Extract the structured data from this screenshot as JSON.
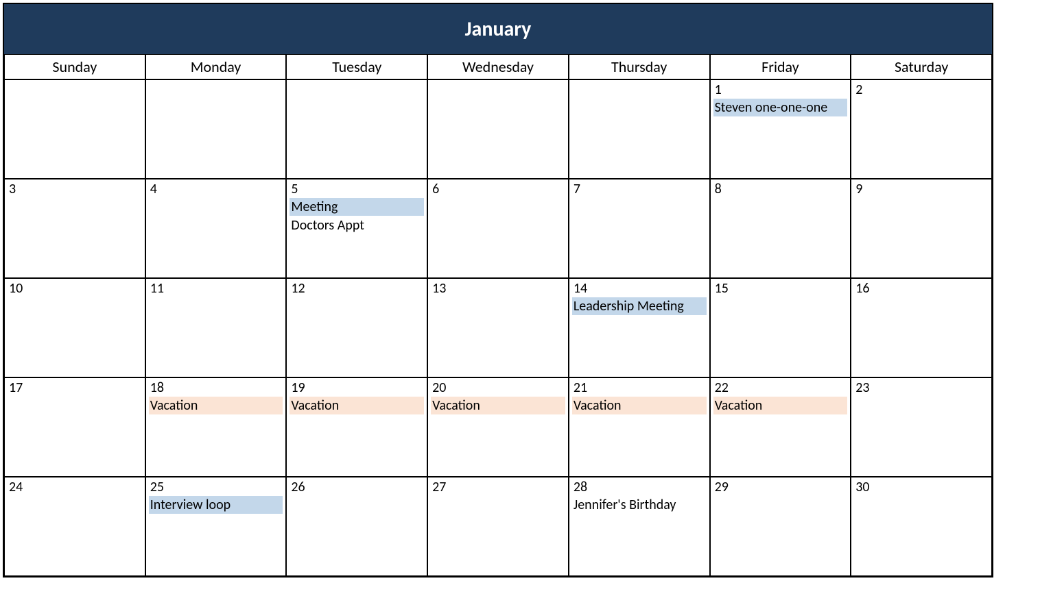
{
  "month_title": "January",
  "day_names": [
    "Sunday",
    "Monday",
    "Tuesday",
    "Wednesday",
    "Thursday",
    "Friday",
    "Saturday"
  ],
  "colors": {
    "header_bg": "#1f3b5c",
    "event_blue": "#c3d7ea",
    "event_peach": "#fbe4d5"
  },
  "weeks": [
    [
      {
        "day": "",
        "events": []
      },
      {
        "day": "",
        "events": []
      },
      {
        "day": "",
        "events": []
      },
      {
        "day": "",
        "events": []
      },
      {
        "day": "",
        "events": []
      },
      {
        "day": "1",
        "events": [
          {
            "label": "Steven one-one-one",
            "style": "blue"
          }
        ]
      },
      {
        "day": "2",
        "events": []
      }
    ],
    [
      {
        "day": "3",
        "events": []
      },
      {
        "day": "4",
        "events": []
      },
      {
        "day": "5",
        "events": [
          {
            "label": "Meeting",
            "style": "blue"
          },
          {
            "label": "Doctors Appt",
            "style": "plain"
          }
        ]
      },
      {
        "day": "6",
        "events": []
      },
      {
        "day": "7",
        "events": []
      },
      {
        "day": "8",
        "events": []
      },
      {
        "day": "9",
        "events": []
      }
    ],
    [
      {
        "day": "10",
        "events": []
      },
      {
        "day": "11",
        "events": []
      },
      {
        "day": "12",
        "events": []
      },
      {
        "day": "13",
        "events": []
      },
      {
        "day": "14",
        "events": [
          {
            "label": "Leadership Meeting",
            "style": "blue"
          }
        ]
      },
      {
        "day": "15",
        "events": []
      },
      {
        "day": "16",
        "events": []
      }
    ],
    [
      {
        "day": "17",
        "events": []
      },
      {
        "day": "18",
        "events": [
          {
            "label": "Vacation",
            "style": "peach"
          }
        ]
      },
      {
        "day": "19",
        "events": [
          {
            "label": "Vacation",
            "style": "peach"
          }
        ]
      },
      {
        "day": "20",
        "events": [
          {
            "label": "Vacation",
            "style": "peach"
          }
        ]
      },
      {
        "day": "21",
        "events": [
          {
            "label": "Vacation",
            "style": "peach"
          }
        ]
      },
      {
        "day": "22",
        "events": [
          {
            "label": "Vacation",
            "style": "peach"
          }
        ]
      },
      {
        "day": "23",
        "events": []
      }
    ],
    [
      {
        "day": "24",
        "events": []
      },
      {
        "day": "25",
        "events": [
          {
            "label": "Interview loop",
            "style": "blue"
          }
        ]
      },
      {
        "day": "26",
        "events": []
      },
      {
        "day": "27",
        "events": []
      },
      {
        "day": "28",
        "events": [
          {
            "label": "Jennifer's Birthday",
            "style": "plain"
          }
        ]
      },
      {
        "day": "29",
        "events": []
      },
      {
        "day": "30",
        "events": []
      }
    ]
  ]
}
